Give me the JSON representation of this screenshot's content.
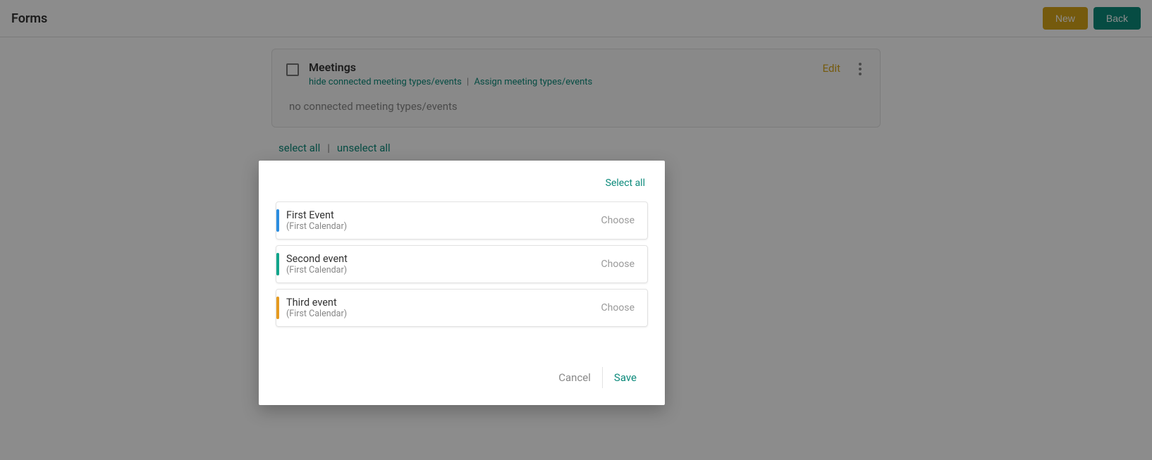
{
  "header": {
    "title": "Forms",
    "new_label": "New",
    "back_label": "Back"
  },
  "card": {
    "title": "Meetings",
    "hide_link": "hide connected meeting types/events",
    "assign_link": "Assign meeting types/events",
    "edit_label": "Edit",
    "empty_text": "no connected meeting types/events"
  },
  "select_row": {
    "select_all": "select all",
    "unselect_all": "unselect all"
  },
  "modal": {
    "select_all": "Select all",
    "cancel": "Cancel",
    "save": "Save",
    "choose_label": "Choose",
    "events": [
      {
        "name": "First Event",
        "calendar": "(First Calendar)",
        "color": "#2b8de0"
      },
      {
        "name": "Second event",
        "calendar": "(First Calendar)",
        "color": "#12a58b"
      },
      {
        "name": "Third event",
        "calendar": "(First Calendar)",
        "color": "#e59a1f"
      }
    ]
  }
}
